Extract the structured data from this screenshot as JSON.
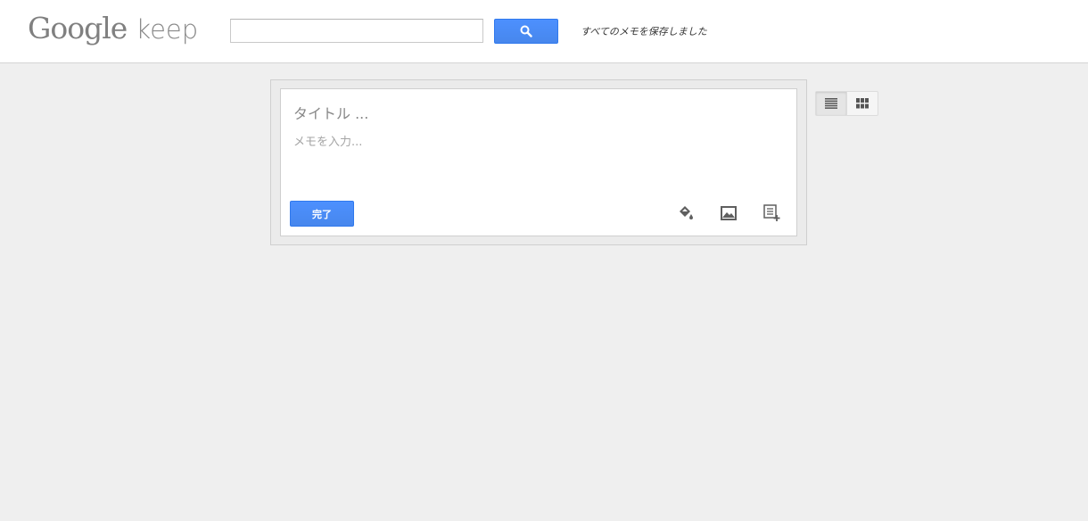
{
  "header": {
    "logo_google": "Google",
    "logo_keep": "keep",
    "search": {
      "value": "",
      "placeholder": ""
    },
    "search_button_icon": "search-icon",
    "status": "すべてのメモを保存しました"
  },
  "note_editor": {
    "title_placeholder": "タイトル ...",
    "body_placeholder": "メモを入力...",
    "done_label": "完了",
    "tools": [
      {
        "icon": "paint-bucket-icon"
      },
      {
        "icon": "image-icon"
      },
      {
        "icon": "checklist-add-icon"
      }
    ]
  },
  "view_toggle": {
    "options": [
      {
        "icon": "list-view-icon",
        "active": true
      },
      {
        "icon": "grid-view-icon",
        "active": false
      }
    ]
  },
  "colors": {
    "accent": "#4d90fe",
    "background": "#efefef",
    "header_bg": "#ffffff"
  }
}
